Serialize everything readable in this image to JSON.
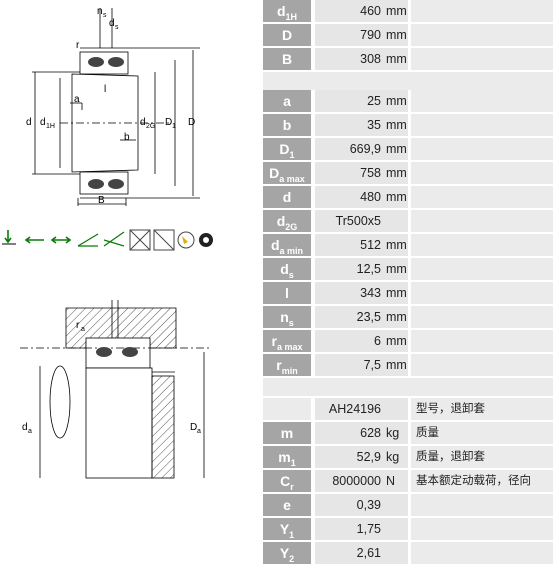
{
  "drawing_top": {
    "labels": {
      "ns": "n",
      "ns_sub": "s",
      "ds": "d",
      "ds_sub": "s",
      "r": "r",
      "l": "l",
      "a": "a",
      "d": "d",
      "d1H": "d",
      "d1H_sub": "1H",
      "d2G": "d",
      "d2G_sub": "2G",
      "D1": "D",
      "D1_sub": "1",
      "D": "D",
      "b": "b",
      "B": "B"
    }
  },
  "drawing_bottom": {
    "labels": {
      "ra": "r",
      "ra_sub": "a",
      "da": "d",
      "da_sub": "a",
      "Da": "D",
      "Da_sub": "a"
    }
  },
  "icons": [
    "radial-load-icon",
    "axial-load-left-icon",
    "axial-load-both-icon",
    "angle-misalignment-icon",
    "angle-misalignment-2-icon",
    "sealed-icon",
    "fire-icon",
    "vibration-icon"
  ],
  "table_group1": [
    {
      "sym": "d",
      "sub": "1H",
      "value": "460",
      "unit": "mm"
    },
    {
      "sym": "D",
      "sub": "",
      "value": "790",
      "unit": "mm"
    },
    {
      "sym": "B",
      "sub": "",
      "value": "308",
      "unit": "mm"
    }
  ],
  "table_group2": [
    {
      "sym": "a",
      "sub": "",
      "value": "25",
      "unit": "mm"
    },
    {
      "sym": "b",
      "sub": "",
      "value": "35",
      "unit": "mm"
    },
    {
      "sym": "D",
      "sub": "1",
      "value": "669,9",
      "unit": "mm"
    },
    {
      "sym": "D",
      "sub": "a max",
      "value": "758",
      "unit": "mm"
    },
    {
      "sym": "d",
      "sub": "",
      "value": "480",
      "unit": "mm"
    },
    {
      "sym": "d",
      "sub": "2G",
      "value": "Tr500x5",
      "unit": ""
    },
    {
      "sym": "d",
      "sub": "a min",
      "value": "512",
      "unit": "mm"
    },
    {
      "sym": "d",
      "sub": "s",
      "value": "12,5",
      "unit": "mm"
    },
    {
      "sym": "l",
      "sub": "",
      "value": "343",
      "unit": "mm"
    },
    {
      "sym": "n",
      "sub": "s",
      "value": "23,5",
      "unit": "mm"
    },
    {
      "sym": "r",
      "sub": "a max",
      "value": "6",
      "unit": "mm"
    },
    {
      "sym": "r",
      "sub": "min",
      "value": "7,5",
      "unit": "mm"
    }
  ],
  "table_group3": [
    {
      "sym": "",
      "sub": "",
      "value": "AH24196",
      "unit": "",
      "desc": "型号，退卸套"
    },
    {
      "sym": "m",
      "sub": "",
      "value": "628",
      "unit": "kg",
      "desc": "质量"
    },
    {
      "sym": "m",
      "sub": "1",
      "value": "52,9",
      "unit": "kg",
      "desc": "质量，退卸套"
    },
    {
      "sym": "C",
      "sub": "r",
      "value": "8000000",
      "unit": "N",
      "desc": "基本额定动载荷，径向"
    },
    {
      "sym": "e",
      "sub": "",
      "value": "0,39",
      "unit": "",
      "desc": ""
    },
    {
      "sym": "Y",
      "sub": "1",
      "value": "1,75",
      "unit": "",
      "desc": ""
    },
    {
      "sym": "Y",
      "sub": "2",
      "value": "2,61",
      "unit": "",
      "desc": ""
    }
  ]
}
